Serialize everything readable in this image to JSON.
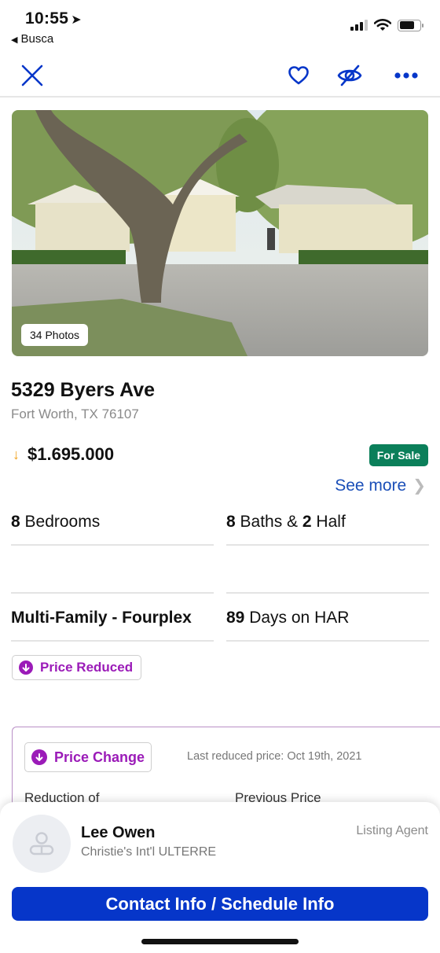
{
  "status_bar": {
    "time": "10:55",
    "back_app": "Busca",
    "battery_level": 0.75,
    "signal_bars": 3
  },
  "toolbar": {
    "close_icon": "close-x-icon",
    "favorite_icon": "heart-icon",
    "hide_icon": "eye-slash-icon",
    "more_icon": "ellipsis-icon"
  },
  "photo": {
    "count_label": "34 Photos"
  },
  "listing": {
    "address": "5329 Byers Ave",
    "city_line": "Fort Worth, TX 76107",
    "price": "$1.695.000",
    "price_trend_icon": "down-arrow-icon",
    "status": "For Sale",
    "see_more": "See more"
  },
  "facts": {
    "bedrooms_value": "8",
    "bedrooms_label": " Bedrooms",
    "baths_value": "8",
    "baths_mid": " Baths & ",
    "half_value": "2",
    "half_label": " Half",
    "property_type": "Multi-Family - Fourplex",
    "days_value": "89",
    "days_label": " Days on HAR"
  },
  "badges": {
    "price_reduced": "Price Reduced"
  },
  "price_change": {
    "chip": "Price Change",
    "last_reduced": "Last reduced price: Oct 19th, 2021",
    "reduction_label": "Reduction of",
    "previous_label": "Previous Price"
  },
  "agent": {
    "name": "Lee Owen",
    "office": "Christie's Int'l ULTERRE",
    "role": "Listing Agent",
    "cta": "Contact Info / Schedule Info"
  },
  "colors": {
    "accent_blue": "#0636c9",
    "link_blue": "#1b4fb8",
    "for_sale_green": "#0b7f5a",
    "price_change_purple": "#9b1bb8",
    "price_down_orange": "#f0a11b"
  }
}
